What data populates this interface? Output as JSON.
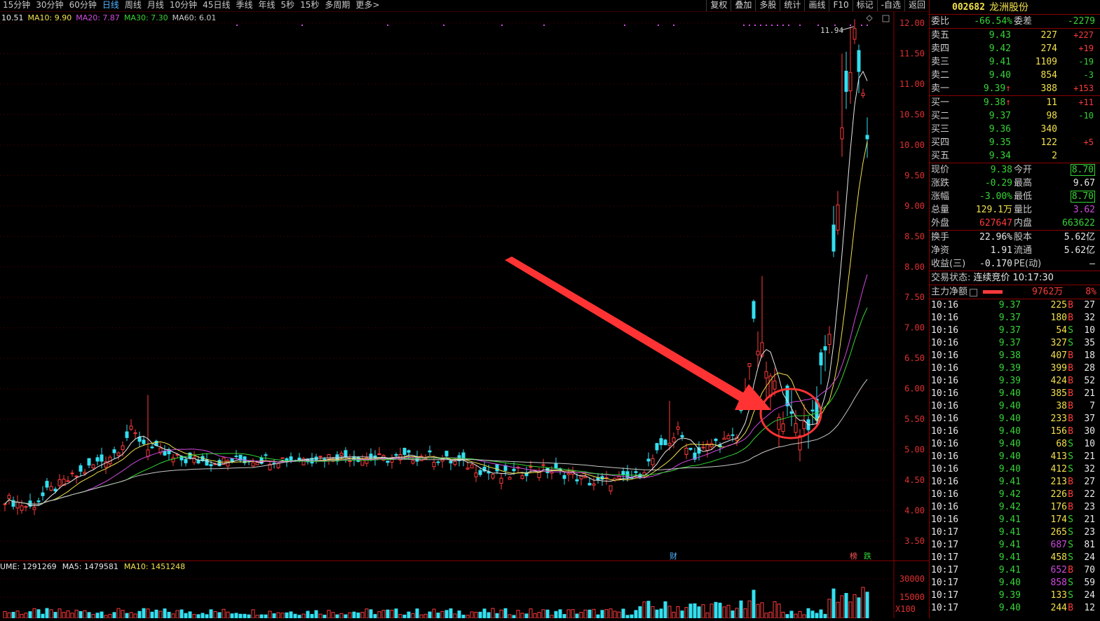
{
  "toolbar": {
    "periods": [
      "15分钟",
      "30分钟",
      "60分钟",
      "日线",
      "周线",
      "月线",
      "10分钟",
      "45日线",
      "季线",
      "年线",
      "5秒",
      "15秒",
      "多周期",
      "更多>"
    ],
    "active_period": "日线",
    "tools": [
      "复权",
      "叠加",
      "多股",
      "统计",
      "画线",
      "F10",
      "标记",
      "-自选",
      "返回"
    ]
  },
  "chart": {
    "ma_legend": [
      {
        "text": "10.51",
        "color": "#e8e8e8"
      },
      {
        "text": "MA10: 9.90",
        "color": "#f2e14c"
      },
      {
        "text": "MA20: 7.87",
        "color": "#d04ae0"
      },
      {
        "text": "MA30: 7.30",
        "color": "#36d436"
      },
      {
        "text": "MA60: 6.01",
        "color": "#c8c8c8"
      }
    ],
    "vol_legend": [
      {
        "text": "UME: 1291269",
        "color": "#e8e8e8"
      },
      {
        "text": "MA5: 1479581",
        "color": "#e8e8e8"
      },
      {
        "text": "MA10: 1451248",
        "color": "#f2e14c"
      }
    ],
    "price_axis": [
      "12.00",
      "11.50",
      "11.00",
      "10.50",
      "10.00",
      "9.50",
      "9.00",
      "8.50",
      "8.00",
      "7.50",
      "7.00",
      "6.50",
      "6.00",
      "5.50",
      "5.00",
      "4.50",
      "4.00",
      "3.50"
    ],
    "volume_axis": [
      "30000",
      "15000"
    ],
    "volume_unit": "X100",
    "high_label": "11.94",
    "markers": [
      "财",
      "榜",
      "跌"
    ],
    "colors": {
      "up": "#ff3b3b",
      "down": "#32e0f0",
      "ma10": "#f2e14c",
      "ma20": "#d04ae0",
      "ma30": "#36d436",
      "ma60": "#c8c8c8",
      "ma5": "#e8e8e8",
      "grid": "#5a0000",
      "annotation": "#ff3333"
    }
  },
  "chart_data": {
    "type": "candlestick",
    "y_range": [
      3.5,
      12.0
    ],
    "price_levels_visible": {
      "high": 11.94
    },
    "ma_latest": {
      "MA10": 9.9,
      "MA20": 7.87,
      "MA30": 7.3,
      "MA60": 6.01
    },
    "volume_latest": {
      "VOLUME": 1291269,
      "MA5": 1479581,
      "MA10": 1451248
    }
  },
  "panel": {
    "code": "002682",
    "name": "龙洲股份",
    "weibi": {
      "label": "委比",
      "value": "-66.54%",
      "label2": "委差",
      "value2": "-2279"
    },
    "asks": [
      {
        "label": "卖五",
        "price": "9.43",
        "vol": "227",
        "chg": "+227"
      },
      {
        "label": "卖四",
        "price": "9.42",
        "vol": "274",
        "chg": "+19"
      },
      {
        "label": "卖三",
        "price": "9.41",
        "vol": "1109",
        "chg": "-19"
      },
      {
        "label": "卖二",
        "price": "9.40",
        "vol": "854",
        "chg": "-3"
      },
      {
        "label": "卖一",
        "price": "9.39",
        "vol": "388",
        "chg": "+153",
        "arrow": "↑"
      }
    ],
    "bids": [
      {
        "label": "买一",
        "price": "9.38",
        "vol": "11",
        "chg": "+11",
        "arrow": "↑"
      },
      {
        "label": "买二",
        "price": "9.37",
        "vol": "98",
        "chg": "-10"
      },
      {
        "label": "买三",
        "price": "9.36",
        "vol": "340",
        "chg": ""
      },
      {
        "label": "买四",
        "price": "9.35",
        "vol": "122",
        "chg": "+5"
      },
      {
        "label": "买五",
        "price": "9.34",
        "vol": "2",
        "chg": ""
      }
    ],
    "quote": [
      {
        "l1": "现价",
        "v1": "9.38",
        "c1": "green",
        "l2": "今开",
        "v2": "8.70",
        "c2": "green",
        "box2": true
      },
      {
        "l1": "涨跌",
        "v1": "-0.29",
        "c1": "green",
        "l2": "最高",
        "v2": "9.67",
        "c2": "white",
        "box2": false
      },
      {
        "l1": "涨幅",
        "v1": "-3.00%",
        "c1": "green",
        "l2": "最低",
        "v2": "8.70",
        "c2": "green",
        "box2": true
      },
      {
        "l1": "总量",
        "v1": "129.1万",
        "c1": "yellow",
        "l2": "量比",
        "v2": "3.62",
        "c2": "purple",
        "box2": false
      },
      {
        "l1": "外盘",
        "v1": "627647",
        "c1": "red",
        "l2": "内盘",
        "v2": "663622",
        "c2": "green",
        "box2": false
      }
    ],
    "fund": [
      {
        "l1": "换手",
        "v1": "22.96%",
        "l2": "股本",
        "v2": "5.62亿"
      },
      {
        "l1": "净资",
        "v1": "1.91",
        "l2": "流通",
        "v2": "5.62亿"
      },
      {
        "l1": "收益(三)",
        "v1": "-0.170",
        "l2": "PE(动)",
        "v2": "—"
      }
    ],
    "status": {
      "label": "交易状态:",
      "value": "连续竞价 10:17:30"
    },
    "mainflow": {
      "label": "主力净额",
      "value": "9762万",
      "pct": "8%"
    },
    "ticks": [
      {
        "t": "10:16",
        "p": "9.37",
        "v": "225",
        "bs": "B",
        "n": "27"
      },
      {
        "t": "10:16",
        "p": "9.37",
        "v": "180",
        "bs": "B",
        "n": "32"
      },
      {
        "t": "10:16",
        "p": "9.37",
        "v": "54",
        "bs": "S",
        "n": "10"
      },
      {
        "t": "10:16",
        "p": "9.37",
        "v": "327",
        "bs": "S",
        "n": "35"
      },
      {
        "t": "10:16",
        "p": "9.38",
        "v": "407",
        "bs": "B",
        "n": "18"
      },
      {
        "t": "10:16",
        "p": "9.39",
        "v": "399",
        "bs": "B",
        "n": "28"
      },
      {
        "t": "10:16",
        "p": "9.39",
        "v": "424",
        "bs": "B",
        "n": "52"
      },
      {
        "t": "10:16",
        "p": "9.40",
        "v": "385",
        "bs": "B",
        "n": "21"
      },
      {
        "t": "10:16",
        "p": "9.40",
        "v": "38",
        "bs": "B",
        "n": "7"
      },
      {
        "t": "10:16",
        "p": "9.40",
        "v": "233",
        "bs": "B",
        "n": "37"
      },
      {
        "t": "10:16",
        "p": "9.40",
        "v": "156",
        "bs": "B",
        "n": "30"
      },
      {
        "t": "10:16",
        "p": "9.40",
        "v": "68",
        "bs": "S",
        "n": "10"
      },
      {
        "t": "10:16",
        "p": "9.40",
        "v": "413",
        "bs": "S",
        "n": "21"
      },
      {
        "t": "10:16",
        "p": "9.40",
        "v": "412",
        "bs": "S",
        "n": "32"
      },
      {
        "t": "10:16",
        "p": "9.41",
        "v": "213",
        "bs": "B",
        "n": "27"
      },
      {
        "t": "10:16",
        "p": "9.42",
        "v": "226",
        "bs": "B",
        "n": "22"
      },
      {
        "t": "10:16",
        "p": "9.42",
        "v": "176",
        "bs": "B",
        "n": "23"
      },
      {
        "t": "10:16",
        "p": "9.41",
        "v": "174",
        "bs": "S",
        "n": "21"
      },
      {
        "t": "10:17",
        "p": "9.41",
        "v": "265",
        "bs": "S",
        "n": "23"
      },
      {
        "t": "10:17",
        "p": "9.41",
        "v": "687",
        "bs": "S",
        "n": "81"
      },
      {
        "t": "10:17",
        "p": "9.41",
        "v": "458",
        "bs": "S",
        "n": "24"
      },
      {
        "t": "10:17",
        "p": "9.41",
        "v": "652",
        "bs": "B",
        "n": "70"
      },
      {
        "t": "10:17",
        "p": "9.40",
        "v": "858",
        "bs": "S",
        "n": "59"
      },
      {
        "t": "10:17",
        "p": "9.39",
        "v": "133",
        "bs": "S",
        "n": "24"
      },
      {
        "t": "10:17",
        "p": "9.40",
        "v": "244",
        "bs": "B",
        "n": "12"
      }
    ]
  }
}
